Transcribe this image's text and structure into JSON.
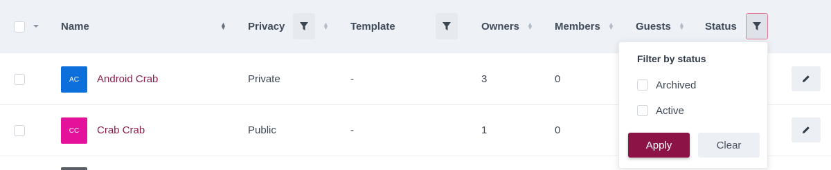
{
  "columns": {
    "name": "Name",
    "privacy": "Privacy",
    "template": "Template",
    "owners": "Owners",
    "members": "Members",
    "guests": "Guests",
    "status": "Status"
  },
  "rows": [
    {
      "initials": "AC",
      "avatar_color": "#0d6fdb",
      "name": "Android Crab",
      "privacy": "Private",
      "template": "-",
      "owners": "3",
      "members": "0"
    },
    {
      "initials": "CC",
      "avatar_color": "#e4119a",
      "name": "Crab Crab",
      "privacy": "Public",
      "template": "-",
      "owners": "1",
      "members": "0"
    }
  ],
  "status_filter": {
    "title": "Filter by status",
    "options": [
      {
        "label": "Archived",
        "checked": false
      },
      {
        "label": "Active",
        "checked": false
      }
    ],
    "apply_label": "Apply",
    "clear_label": "Clear"
  },
  "colors": {
    "header_bg": "#eef1f6",
    "name_link": "#8a1c4c",
    "apply_bg": "#8c1346"
  },
  "icons": {
    "filter": "funnel-icon",
    "edit": "pencil-icon",
    "sort": "sort-arrows-icon",
    "select_menu": "caret-down-icon"
  }
}
